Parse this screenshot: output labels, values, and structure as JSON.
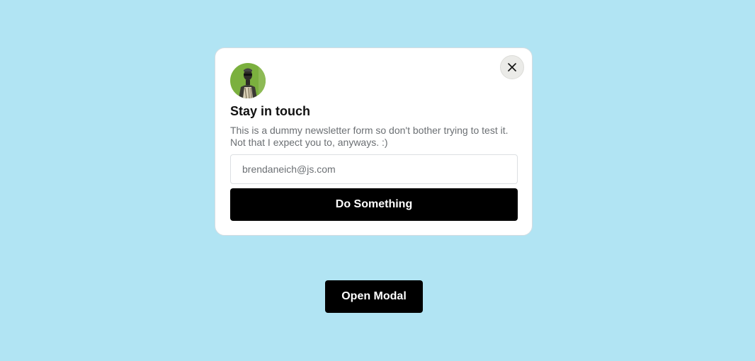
{
  "modal": {
    "title": "Stay in touch",
    "description": "This is a dummy newsletter form so don't bother trying to test it. Not that I expect you to, anyways. :)",
    "email_placeholder": "brendaneich@js.com",
    "email_value": "",
    "submit_label": "Do Something",
    "close_icon": "close-icon",
    "avatar_icon": "avatar"
  },
  "page": {
    "open_modal_label": "Open Modal"
  },
  "colors": {
    "background": "#b1e4f3",
    "button": "#000000",
    "button_text": "#ffffff",
    "avatar_bg": "#7bb03e"
  }
}
